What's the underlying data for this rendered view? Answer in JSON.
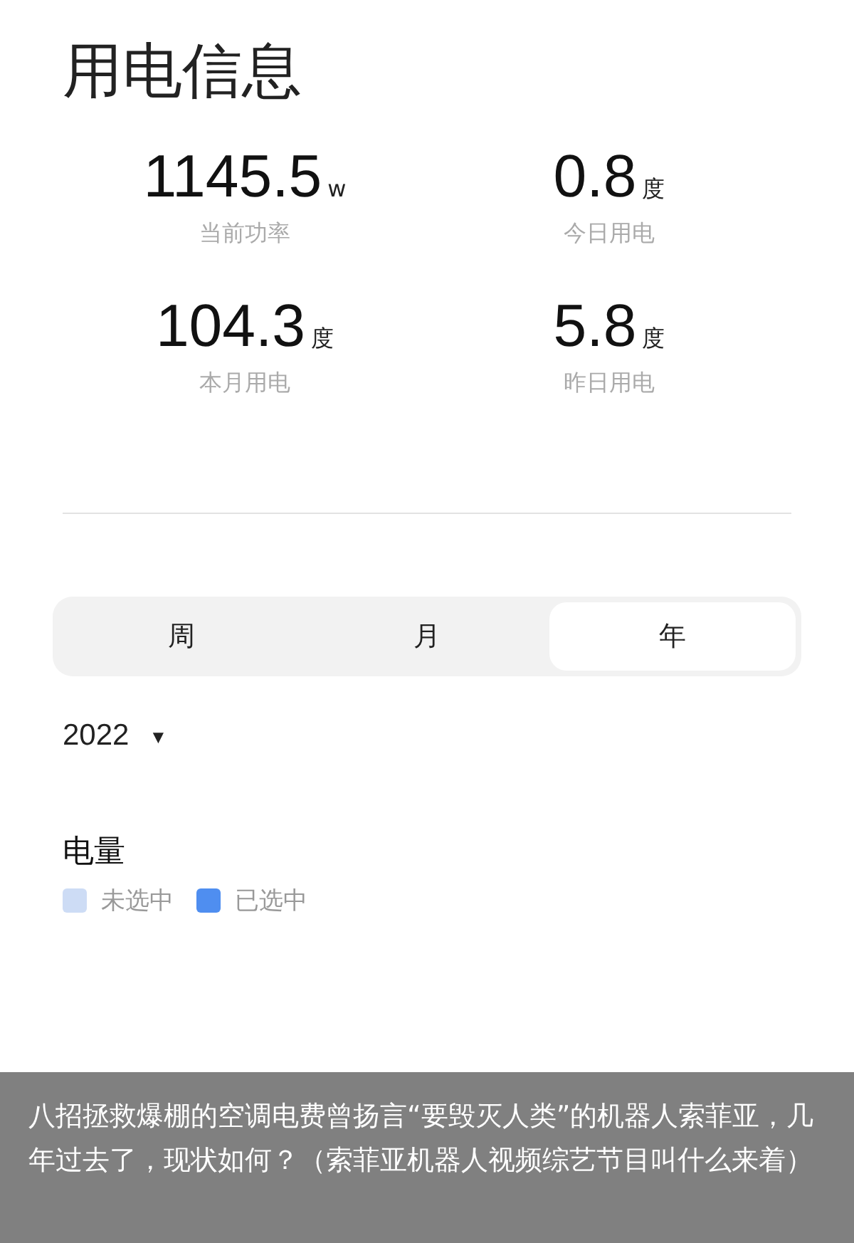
{
  "title": "用电信息",
  "stats": [
    {
      "value": "1145.5",
      "unit": "w",
      "label": "当前功率"
    },
    {
      "value": "0.8",
      "unit": "度",
      "label": "今日用电"
    },
    {
      "value": "104.3",
      "unit": "度",
      "label": "本月用电"
    },
    {
      "value": "5.8",
      "unit": "度",
      "label": "昨日用电"
    }
  ],
  "tabs": [
    {
      "label": "周",
      "selected": false
    },
    {
      "label": "月",
      "selected": false
    },
    {
      "label": "年",
      "selected": true
    }
  ],
  "year": {
    "value": "2022",
    "caret": "▼"
  },
  "chart_section": {
    "title": "电量",
    "legend": [
      {
        "label": "未选中",
        "color": "#cddcf5"
      },
      {
        "label": "已选中",
        "color": "#4f8ef0"
      }
    ]
  },
  "caption": "八招拯救爆棚的空调电费曾扬言“要毁灭人类”的机器人索菲亚，几年过去了，现状如何？（索菲亚机器人视频综艺节目叫什么来着）"
}
